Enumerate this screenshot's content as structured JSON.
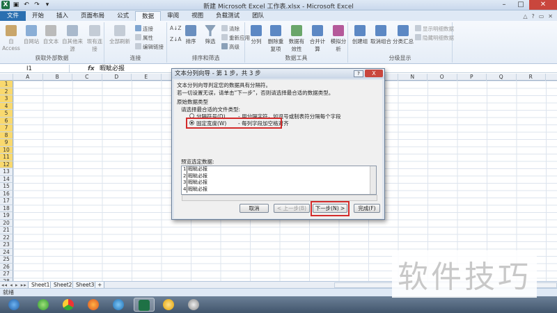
{
  "window": {
    "title": "新建 Microsoft Excel 工作表.xlsx - Microsoft Excel"
  },
  "tabs": [
    "文件",
    "开始",
    "插入",
    "页面布局",
    "公式",
    "数据",
    "审阅",
    "视图",
    "负载测试",
    "团队"
  ],
  "active_tab": "数据",
  "ribbon": {
    "groups": [
      {
        "label": "获取外部数据",
        "buttons": [
          "自 Access",
          "自网站",
          "自文本",
          "自其他来源",
          "现有连接"
        ]
      },
      {
        "label": "连接",
        "buttons": [
          "全部刷新"
        ],
        "small": [
          "连接",
          "属性",
          "编辑链接"
        ]
      },
      {
        "label": "排序和筛选",
        "buttons": [
          "排序",
          "筛选"
        ],
        "small": [
          "清除",
          "重新应用",
          "高级"
        ]
      },
      {
        "label": "数据工具",
        "buttons": [
          "分列",
          "删除重复项",
          "数据有效性",
          "合并计算",
          "模拟分析"
        ]
      },
      {
        "label": "分级显示",
        "buttons": [
          "创建组",
          "取消组合",
          "分类汇总"
        ],
        "small": [
          "显示明细数据",
          "隐藏明细数据"
        ]
      }
    ]
  },
  "formula_bar": {
    "cell": "I1",
    "fx": "fx",
    "content": "暇眦必报"
  },
  "columns": [
    "A",
    "B",
    "C",
    "D",
    "E",
    "F",
    "G",
    "H",
    "I",
    "J",
    "K",
    "L",
    "M",
    "N",
    "O",
    "P",
    "Q",
    "R"
  ],
  "rows": [
    "1",
    "2",
    "3",
    "4",
    "5",
    "6",
    "7",
    "8",
    "9",
    "10",
    "11",
    "12",
    "13",
    "14",
    "15",
    "16",
    "17",
    "18",
    "19",
    "20",
    "21",
    "22",
    "23",
    "24",
    "25",
    "26",
    "27",
    "28"
  ],
  "sheets": [
    "Sheet1",
    "Sheet2",
    "Sheet3"
  ],
  "status": "就绪",
  "watermark": "软件技巧",
  "dialog": {
    "title": "文本分列向导 - 第 1 步，共 3 步",
    "help": "?",
    "close": "X",
    "line1": "文本分列向导判定您的数据具有分隔符。",
    "line2": "若一切设置无误，请单击“下一步”，否则请选择最合适的数据类型。",
    "section": "原始数据类型",
    "prompt": "请选择最合适的文件类型:",
    "option1": "分隔符号(D)",
    "option1_desc": "- 用分隔字符，如逗号或制表符分隔每个字段",
    "option2": "固定宽度(W)",
    "option2_desc": "- 每列字段加空格对齐",
    "preview_label": "预览选定数据:",
    "preview_rows": [
      {
        "n": "1",
        "text": "暇眦必报"
      },
      {
        "n": "2",
        "text": "暇眦必报"
      },
      {
        "n": "3",
        "text": "暇眦必报"
      },
      {
        "n": "4",
        "text": "暇眦必报"
      }
    ],
    "buttons": {
      "cancel": "取消",
      "back": "< 上一步(B)",
      "next": "下一步(N) >",
      "finish": "完成(F)"
    }
  }
}
